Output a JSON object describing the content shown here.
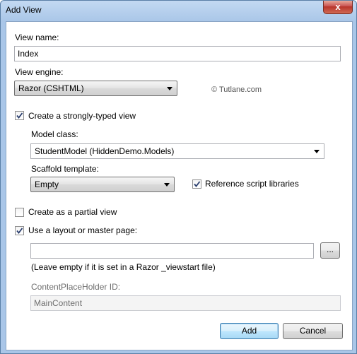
{
  "window": {
    "title": "Add View",
    "close_glyph": "x"
  },
  "view_name": {
    "label": "View name:",
    "value": "Index"
  },
  "view_engine": {
    "label": "View engine:",
    "selected": "Razor (CSHTML)"
  },
  "watermark": "© Tutlane.com",
  "strongly_typed": {
    "label": "Create a strongly-typed view",
    "checked": true
  },
  "model_class": {
    "label": "Model class:",
    "selected": "StudentModel (HiddenDemo.Models)"
  },
  "scaffold": {
    "label": "Scaffold template:",
    "selected": "Empty"
  },
  "reference_scripts": {
    "label": "Reference script libraries",
    "checked": true
  },
  "partial_view": {
    "label": "Create as a partial view",
    "checked": false
  },
  "layout": {
    "label": "Use a layout or master page:",
    "checked": true,
    "path_value": "",
    "browse_label": "...",
    "hint": "(Leave empty if it is set in a Razor _viewstart file)"
  },
  "content_placeholder": {
    "label": "ContentPlaceHolder ID:",
    "value": "MainContent"
  },
  "buttons": {
    "add": "Add",
    "cancel": "Cancel"
  }
}
